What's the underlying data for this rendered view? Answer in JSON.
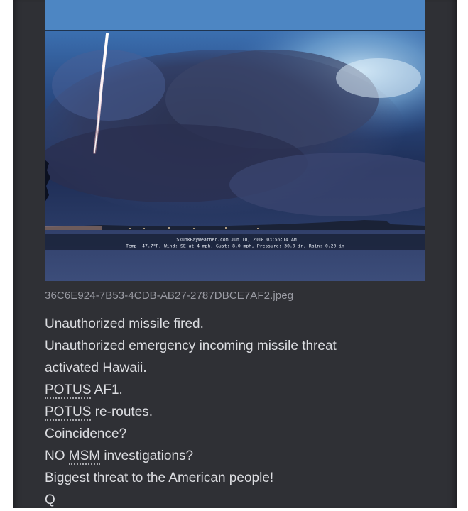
{
  "post": {
    "image": {
      "overlay_line1": "SkunkBayWeather.com  Jun 10, 2018  03:56:14 AM",
      "overlay_line2": "Temp:  47.7°F, Wind: SE  at    4 mph, Gust:  8.0 mph, Pressure:  30.0 in, Rain: 0.20 in"
    },
    "filename": "36C6E924-7B53-4CDB-AB27-2787DBCE7AF2.jpeg",
    "lines": {
      "l1": "Unauthorized missile fired.",
      "l2": "Unauthorized emergency incoming missile threat activated Hawaii.",
      "l3_abbr": "POTUS",
      "l3_rest": " AF1.",
      "l4_abbr": "POTUS",
      "l4_rest": " re-routes.",
      "l5": "Coincidence?",
      "l6_pre": "NO ",
      "l6_abbr": "MSM",
      "l6_rest": " investigations?",
      "l7": "Biggest threat to the American people!",
      "l8": "Q"
    }
  },
  "colors": {
    "panel": "#2f3035",
    "text": "#dcdde1",
    "filename": "#9a9ba3"
  }
}
